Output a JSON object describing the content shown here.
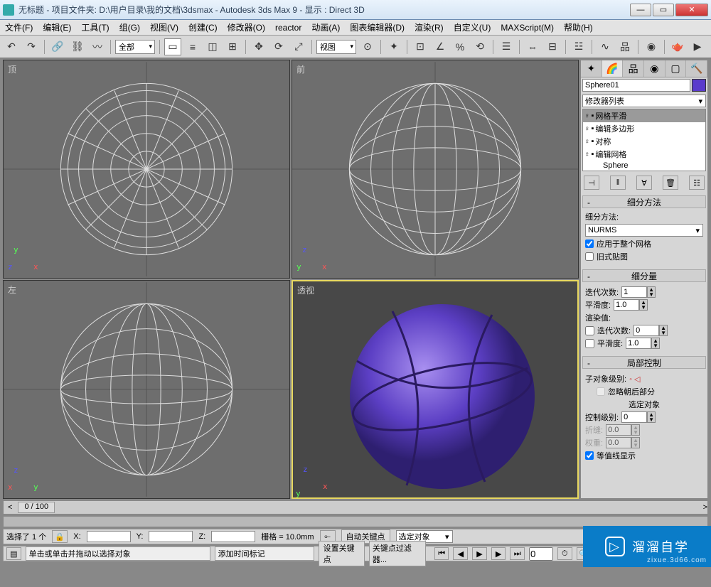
{
  "window": {
    "title": "无标题    - 项目文件夹: D:\\用户目录\\我的文档\\3dsmax    - Autodesk 3ds Max 9    - 显示 : Direct 3D"
  },
  "menu": [
    "文件(F)",
    "编辑(E)",
    "工具(T)",
    "组(G)",
    "视图(V)",
    "创建(C)",
    "修改器(O)",
    "reactor",
    "动画(A)",
    "图表编辑器(D)",
    "渲染(R)",
    "自定义(U)",
    "MAXScript(M)",
    "帮助(H)"
  ],
  "toolbar": {
    "filter": "全部",
    "viewmode": "视图"
  },
  "viewports": {
    "topleft": "顶",
    "topright": "前",
    "botleft": "左",
    "botright": "透视"
  },
  "cmd": {
    "object_name": "Sphere01",
    "modlist_label": "修改器列表",
    "stack": [
      "网格平滑",
      "编辑多边形",
      "对称",
      "编辑网格",
      "Sphere"
    ],
    "roll1": {
      "title": "细分方法",
      "method_label": "细分方法:",
      "method_value": "NURMS",
      "chk_whole": "应用于整个网格",
      "chk_oldmap": "旧式贴图"
    },
    "roll2": {
      "title": "细分量",
      "iter_label": "迭代次数:",
      "iter_val": "1",
      "smooth_label": "平滑度:",
      "smooth_val": "1.0",
      "render_label": "渲染值:",
      "r_iter_val": "0",
      "r_smooth_val": "1.0"
    },
    "roll3": {
      "title": "局部控制",
      "sublvl": "子对象级别:",
      "ignore_back": "忽略朝后部分",
      "selobj": "选定对象",
      "ctrl_lvl": "控制级别:",
      "ctrl_val": "0",
      "crease": "折缝:",
      "crease_val": "0.0",
      "weight": "权重:",
      "weight_val": "0.0",
      "iso": "等值线显示"
    }
  },
  "timeslider": "0 / 100",
  "status": {
    "sel": "选择了 1 个",
    "x": "X:",
    "y": "Y:",
    "z": "Z:",
    "grid": "栅格 = 10.0mm",
    "autokey": "自动关键点",
    "selobj": "选定对象",
    "prompt": "单击或单击并拖动以选择对象",
    "addtime": "添加时间标记",
    "setkey": "设置关键点",
    "keyfilter": "关键点过滤器..."
  },
  "watermark": {
    "brand": "溜溜自学",
    "url": "zixue.3d66.com"
  }
}
